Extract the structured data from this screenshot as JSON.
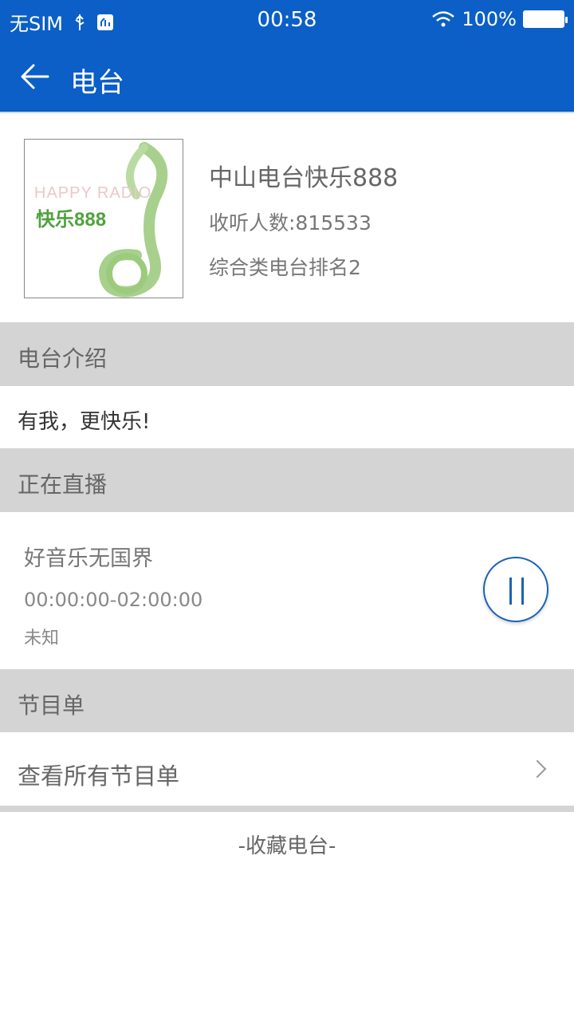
{
  "status_bar": {
    "carrier": "无SIM",
    "time": "00:58",
    "battery": "100%"
  },
  "nav": {
    "title": "电台"
  },
  "station": {
    "name": "中山电台快乐888",
    "listeners": "收听人数:815533",
    "rank": "综合类电台排名2",
    "cover_text": "快乐888",
    "cover_ghost": "HAPPY RADIO"
  },
  "intro": {
    "heading": "电台介绍",
    "text": "有我，更快乐!"
  },
  "live": {
    "heading": "正在直播",
    "program_title": "好音乐无国界",
    "time_range": "00:00:00-02:00:00",
    "host": "未知"
  },
  "schedule": {
    "heading": "节目单",
    "view_all": "查看所有节目单"
  },
  "favorite": {
    "label": "-收藏电台-"
  },
  "colors": {
    "primary": "#0b5fc6",
    "section_bg": "#d4d4d4",
    "play_button": "#1a63b8"
  }
}
